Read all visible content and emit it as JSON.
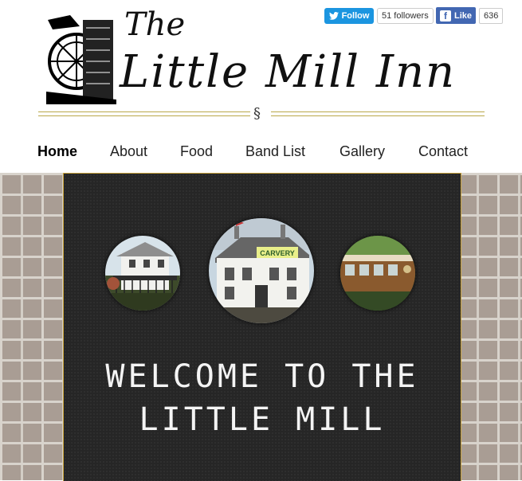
{
  "header": {
    "logo_the": "The",
    "logo_title": "Little Mill Inn",
    "section_mark": "§"
  },
  "social": {
    "twitter_follow_label": "Follow",
    "twitter_followers": "51 followers",
    "facebook_like_label": "Like",
    "facebook_count": "636",
    "twitter_color": "#1b95e0",
    "facebook_color": "#4267b2"
  },
  "nav": {
    "items": [
      {
        "label": "Home",
        "active": true
      },
      {
        "label": "About"
      },
      {
        "label": "Food"
      },
      {
        "label": "Band List"
      },
      {
        "label": "Gallery"
      },
      {
        "label": "Contact"
      }
    ]
  },
  "hero": {
    "welcome_line1": "Welcome to the",
    "welcome_line2": "Little Mill",
    "images": [
      {
        "name": "balcony-photo"
      },
      {
        "name": "inn-building-photo"
      },
      {
        "name": "railway-carriage-photo"
      }
    ]
  },
  "colors": {
    "accent_gold": "#c9a33c",
    "chalkboard": "#262626",
    "brick": "#a99d94"
  }
}
